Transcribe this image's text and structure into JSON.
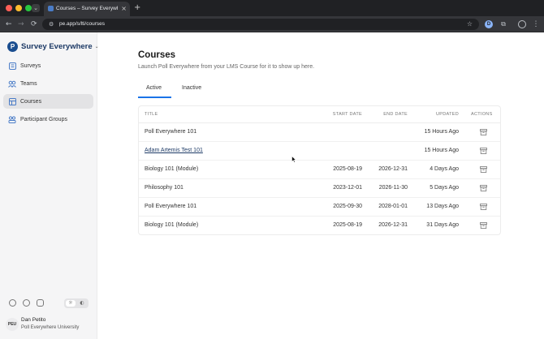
{
  "browser": {
    "tab_title": "Courses – Survey Everywhere",
    "tab_close": "×",
    "new_tab": "+",
    "tab_dropdown": "⌄",
    "url": "pe.app/s/lti/courses",
    "back": "←",
    "forward": "→",
    "reload": "⟳",
    "omni_icon": "⚙",
    "star": "☆",
    "extension_badge": "D",
    "menu": "⋮",
    "puzzle": "⧉"
  },
  "sidebar": {
    "brand": "Survey Everywhere",
    "brand_logo": "P",
    "brand_caret": "⌄",
    "items": [
      {
        "label": "Surveys",
        "icon": "surveys-icon",
        "active": false
      },
      {
        "label": "Teams",
        "icon": "teams-icon",
        "active": false
      },
      {
        "label": "Courses",
        "icon": "courses-icon",
        "active": true
      },
      {
        "label": "Participant Groups",
        "icon": "participant-groups-icon",
        "active": false
      }
    ],
    "theme": {
      "light": "☼",
      "dark": "◐"
    },
    "user": {
      "initials": "PEU",
      "name": "Dan Petito",
      "org": "Poll Everywhere University"
    }
  },
  "main": {
    "title": "Courses",
    "subtitle": "Launch Poll Everywhere from your LMS Course for it to show up here.",
    "tabs": [
      {
        "label": "Active",
        "selected": true
      },
      {
        "label": "Inactive",
        "selected": false
      }
    ],
    "table": {
      "headers": {
        "title": "TITLE",
        "start_date": "START DATE",
        "end_date": "END DATE",
        "updated": "UPDATED",
        "actions": "ACTIONS"
      },
      "rows": [
        {
          "title": "Poll Everywhere 101",
          "start": "",
          "end": "",
          "updated": "15 Hours Ago",
          "link": false
        },
        {
          "title": "Adam Artemis Test 101",
          "start": "",
          "end": "",
          "updated": "15 Hours Ago",
          "link": true
        },
        {
          "title": "Biology 101 (Module)",
          "start": "2025-08-19",
          "end": "2026-12-31",
          "updated": "4 Days Ago",
          "link": false
        },
        {
          "title": "Philosophy 101",
          "start": "2023-12-01",
          "end": "2026-11-30",
          "updated": "5 Days Ago",
          "link": false
        },
        {
          "title": "Poll Everywhere 101",
          "start": "2025-09-30",
          "end": "2028-01-01",
          "updated": "13 Days Ago",
          "link": false
        },
        {
          "title": "Biology 101 (Module)",
          "start": "2025-08-19",
          "end": "2026-12-31",
          "updated": "31 Days Ago",
          "link": false
        }
      ]
    }
  },
  "colors": {
    "accent": "#1a73e8",
    "brand": "#1d3a66",
    "sidebar_bg": "#f5f5f6",
    "active_nav_bg": "#e3e3e5"
  }
}
